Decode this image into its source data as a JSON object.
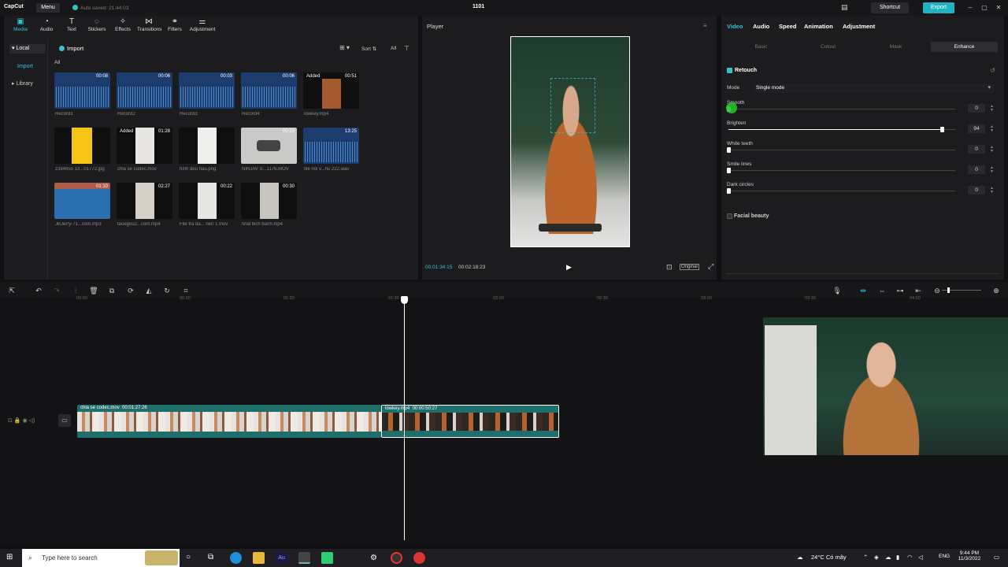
{
  "titlebar": {
    "logo": "CapCut",
    "menu": "Menu",
    "autosave": "Auto saved: 21:44:03",
    "project_name": "1101",
    "shortcut": "Shortcut",
    "export": "Export"
  },
  "media_toolbar": {
    "tabs": [
      {
        "label": "Media",
        "icon": "media-icon"
      },
      {
        "label": "Audio",
        "icon": "audio-icon"
      },
      {
        "label": "Text",
        "icon": "text-icon"
      },
      {
        "label": "Stickers",
        "icon": "stickers-icon"
      },
      {
        "label": "Effects",
        "icon": "effects-icon"
      },
      {
        "label": "Transitions",
        "icon": "transitions-icon"
      },
      {
        "label": "Filters",
        "icon": "filters-icon"
      },
      {
        "label": "Adjustment",
        "icon": "adjustment-icon"
      }
    ]
  },
  "sidebar": {
    "local": "Local",
    "import": "Import",
    "library": "Library"
  },
  "media": {
    "import_label": "Import",
    "sort_label": "Sort",
    "all_label": "All",
    "filter_all": "All",
    "items": [
      {
        "name": "Record1",
        "duration": "00:08",
        "added": ""
      },
      {
        "name": "Record2",
        "duration": "00:06",
        "added": ""
      },
      {
        "name": "Record3",
        "duration": "00:03",
        "added": ""
      },
      {
        "name": "Record4",
        "duration": "00:06",
        "added": ""
      },
      {
        "name": "lowkey.mp4",
        "duration": "00:51",
        "added": "Added"
      },
      {
        "name": "z384655 13...01772.jpg",
        "duration": "",
        "added": ""
      },
      {
        "name": "chia se codec.mov",
        "duration": "01:28",
        "added": "Added"
      },
      {
        "name": "hinh deu hau.png",
        "duration": "",
        "added": ""
      },
      {
        "name": "NINJAV S...1176.MOV",
        "duration": "00:23",
        "added": ""
      },
      {
        "name": "tile noi v...hu 222.wav",
        "duration": "13:25",
        "added": ""
      },
      {
        "name": "JBJerry-71...com.mp3",
        "duration": "01:10",
        "added": ""
      },
      {
        "name": "taoegou2...com.mp4",
        "duration": "02:27",
        "added": ""
      },
      {
        "name": "File tra da... rien 1.mov",
        "duration": "00:22",
        "added": ""
      },
      {
        "name": "final bich banh.mp4",
        "duration": "00:30",
        "added": ""
      }
    ]
  },
  "player": {
    "title": "Player",
    "current_time": "00:01:34:15",
    "total_time": "00:02:18:23",
    "ratio_label": "Original"
  },
  "properties": {
    "tabs": [
      "Video",
      "Audio",
      "Speed",
      "Animation",
      "Adjustment"
    ],
    "subtabs": [
      "Basic",
      "Cutout",
      "Mask",
      "Enhance"
    ],
    "retouch_label": "Retouch",
    "mode_label": "Mode",
    "mode_value": "Single mode",
    "sliders": [
      {
        "label": "Smooth",
        "value": "0",
        "fraction": 0.0
      },
      {
        "label": "Brighten",
        "value": "94",
        "fraction": 0.94
      },
      {
        "label": "White teeth",
        "value": "0",
        "fraction": 0.0
      },
      {
        "label": "Smile lines",
        "value": "0",
        "fraction": 0.0
      },
      {
        "label": "Dark circles",
        "value": "0",
        "fraction": 0.0
      }
    ],
    "facial_beauty_label": "Facial beauty"
  },
  "timeline": {
    "ruler": [
      "00:00",
      "00:30",
      "01:00",
      "01:30",
      "02:00",
      "02:30",
      "03:00",
      "03:30",
      "04:00"
    ],
    "clips": [
      {
        "name": "chia se codec.mov",
        "duration": "00:01:27:26"
      },
      {
        "name": "lowkey.mp4",
        "duration": "00:00:50:27"
      }
    ]
  },
  "taskbar": {
    "search_placeholder": "Type here to search",
    "weather": "24°C Có mây",
    "lang": "ENG",
    "time": "9:44 PM",
    "date": "11/3/2022"
  },
  "colors": {
    "accent": "#2ec4d4",
    "clip": "#1e6f6b",
    "export": "#1fb4c4"
  }
}
